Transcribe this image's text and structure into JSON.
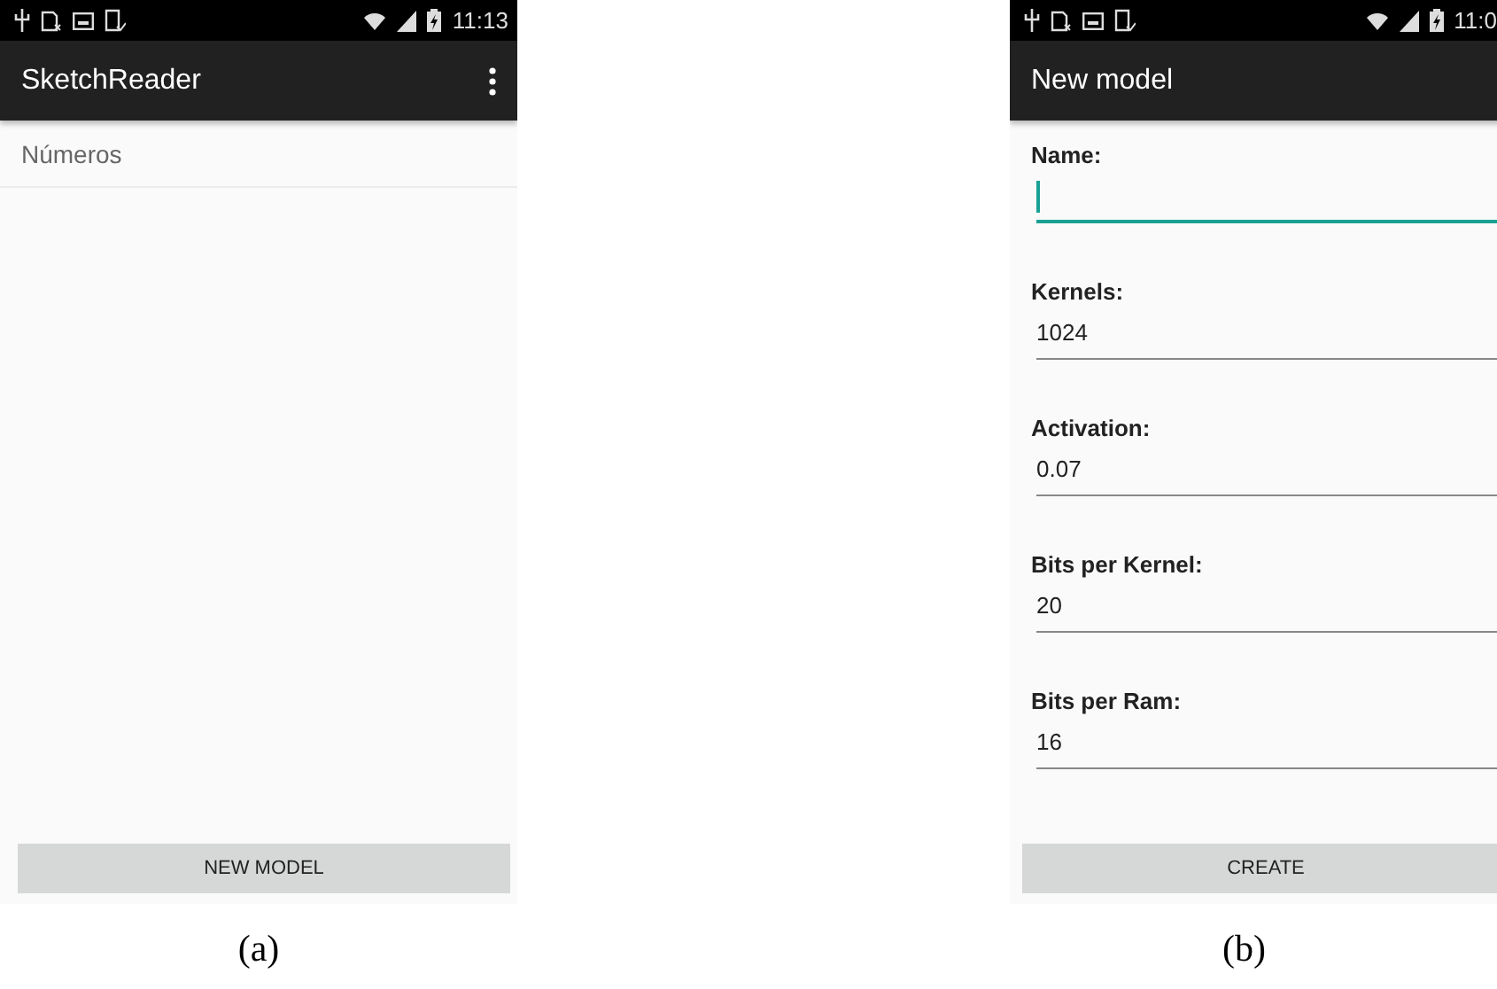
{
  "screens": [
    {
      "status_bar": {
        "time": "11:13"
      },
      "app_bar": {
        "title": "SketchReader",
        "menu": true
      },
      "list": [
        {
          "label": "Números"
        }
      ],
      "button": "NEW MODEL",
      "caption": "(a)"
    },
    {
      "status_bar": {
        "time": "11:0"
      },
      "app_bar": {
        "title": "New model",
        "menu": false
      },
      "fields": [
        {
          "label": "Name:",
          "focused": true
        },
        {
          "label": "Kernels:",
          "value": "1024",
          "focused": false
        },
        {
          "label": "Activation:",
          "value": "0.07",
          "focused": false
        },
        {
          "label": "Bits per Kernel:",
          "value": "20",
          "focused": false
        },
        {
          "label": "Bits per Ram:",
          "value": "16",
          "focused": false
        }
      ],
      "button": "CREATE",
      "caption": "(b)"
    }
  ]
}
